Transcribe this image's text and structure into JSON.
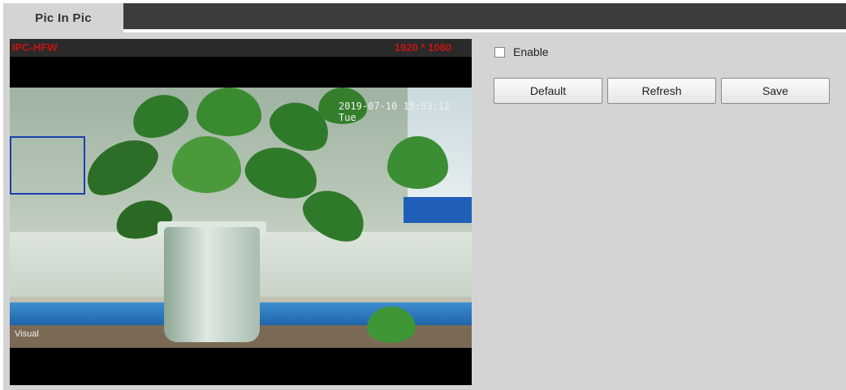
{
  "tab": {
    "label": "Pic In Pic"
  },
  "video": {
    "osd_channel": "IPC-HFW",
    "osd_resolution": "1920 * 1080",
    "osd_time": "2019-07-10 15:53:12 Tue",
    "osd_label": "Visual"
  },
  "controls": {
    "enable_label": "Enable",
    "enable_checked": false,
    "default_label": "Default",
    "refresh_label": "Refresh",
    "save_label": "Save"
  }
}
